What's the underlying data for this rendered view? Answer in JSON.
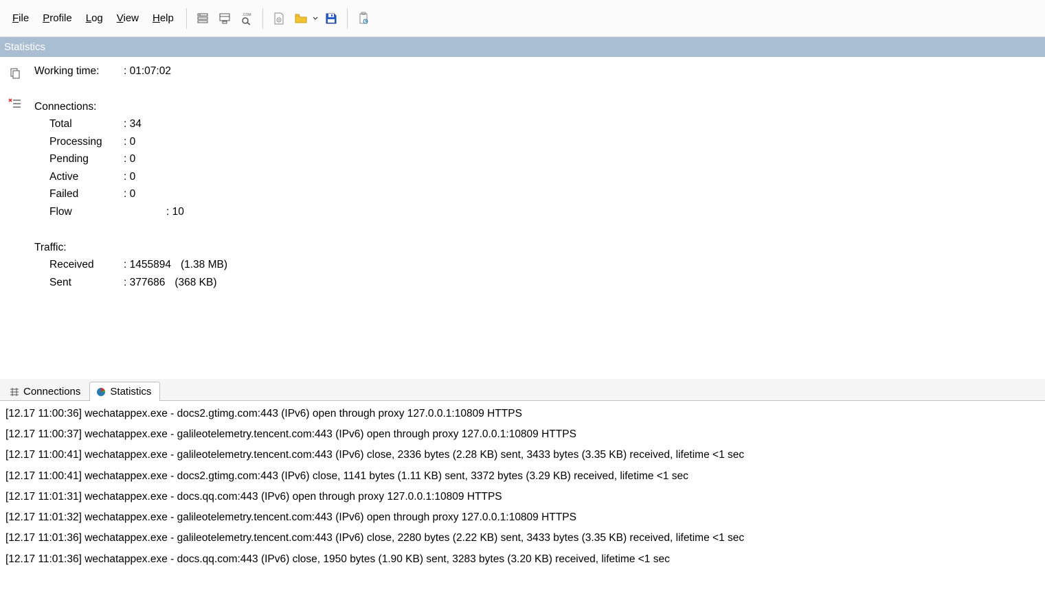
{
  "menu": {
    "file": "File",
    "profile": "Profile",
    "log": "Log",
    "view": "View",
    "help": "Help"
  },
  "panel": {
    "title": "Statistics"
  },
  "stats": {
    "working_time_label": "Working time:",
    "working_time_value": ": 01:07:02",
    "connections_label": "Connections:",
    "total_label": "Total",
    "total_value": ": 34",
    "processing_label": "Processing",
    "processing_value": ": 0",
    "pending_label": "Pending",
    "pending_value": ": 0",
    "active_label": "Active",
    "active_value": ": 0",
    "failed_label": "Failed",
    "failed_value": ": 0",
    "flow_label": "Flow",
    "flow_value": ": 10",
    "traffic_label": "Traffic:",
    "received_label": "Received",
    "received_bytes": ": 1455894",
    "received_human": "(1.38 MB)",
    "sent_label": "Sent",
    "sent_bytes": ": 377686",
    "sent_human": "(368 KB)"
  },
  "tabs": {
    "connections": "Connections",
    "statistics": "Statistics"
  },
  "log": [
    "[12.17 11:00:36] wechatappex.exe - docs2.gtimg.com:443 (IPv6) open through proxy 127.0.0.1:10809 HTTPS",
    "[12.17 11:00:37] wechatappex.exe - galileotelemetry.tencent.com:443 (IPv6) open through proxy 127.0.0.1:10809 HTTPS",
    "[12.17 11:00:41] wechatappex.exe - galileotelemetry.tencent.com:443 (IPv6) close, 2336 bytes (2.28 KB) sent, 3433 bytes (3.35 KB) received, lifetime <1 sec",
    "[12.17 11:00:41] wechatappex.exe - docs2.gtimg.com:443 (IPv6) close, 1141 bytes (1.11 KB) sent, 3372 bytes (3.29 KB) received, lifetime <1 sec",
    "[12.17 11:01:31] wechatappex.exe - docs.qq.com:443 (IPv6) open through proxy 127.0.0.1:10809 HTTPS",
    "[12.17 11:01:32] wechatappex.exe - galileotelemetry.tencent.com:443 (IPv6) open through proxy 127.0.0.1:10809 HTTPS",
    "[12.17 11:01:36] wechatappex.exe - galileotelemetry.tencent.com:443 (IPv6) close, 2280 bytes (2.22 KB) sent, 3433 bytes (3.35 KB) received, lifetime <1 sec",
    "[12.17 11:01:36] wechatappex.exe - docs.qq.com:443 (IPv6) close, 1950 bytes (1.90 KB) sent, 3283 bytes (3.20 KB) received, lifetime <1 sec"
  ]
}
